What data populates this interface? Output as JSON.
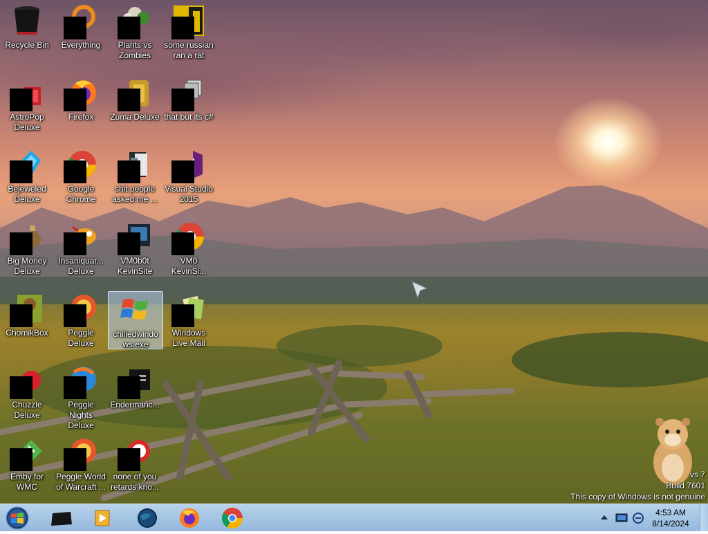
{
  "desktop_icons": [
    {
      "label": "Recycle Bin",
      "icon": "recycle-bin-icon"
    },
    {
      "label": "Everything",
      "icon": "everything-icon"
    },
    {
      "label": "Plants vs Zombies",
      "icon": "plants-vs-zombies-icon"
    },
    {
      "label": "some russian ran a rat",
      "icon": "pie-icon"
    },
    {
      "label": "AstroPop Deluxe",
      "icon": "astropop-icon"
    },
    {
      "label": "Firefox",
      "icon": "firefox-icon"
    },
    {
      "label": "Zuma Deluxe",
      "icon": "zuma-icon"
    },
    {
      "label": "that but its c#",
      "icon": "folder-stack-icon"
    },
    {
      "label": "Bejeweled Deluxe",
      "icon": "bejeweled-icon"
    },
    {
      "label": "Google Chrome",
      "icon": "chrome-icon"
    },
    {
      "label": "shit people asked me ...",
      "icon": "folder-icon"
    },
    {
      "label": "Visual Studio 2015",
      "icon": "visual-studio-icon"
    },
    {
      "label": "Big Money Deluxe",
      "icon": "big-money-icon"
    },
    {
      "label": "Insaniquar... Deluxe",
      "icon": "insaniquarium-icon"
    },
    {
      "label": "VM0b0t KevinSite",
      "icon": "vm-terminal-icon"
    },
    {
      "label": "VM0 KevinSi...",
      "icon": "chrome-icon"
    },
    {
      "label": "ChomikBox",
      "icon": "chomikbox-icon"
    },
    {
      "label": "Peggle Deluxe",
      "icon": "peggle-icon"
    },
    {
      "label": "chilledwindows.exe",
      "icon": "windows-logo-icon"
    },
    {
      "label": "Windows Live Mail",
      "icon": "windows-live-mail-icon"
    },
    {
      "label": "Chuzzle Deluxe",
      "icon": "chuzzle-icon"
    },
    {
      "label": "Peggle Nights Deluxe",
      "icon": "peggle-nights-icon"
    },
    {
      "label": "Endermanc...",
      "icon": "terminal-icon"
    },
    {
      "label": "Emby for WMC",
      "icon": "emby-icon"
    },
    {
      "label": "Peggle World of Warcraft ...",
      "icon": "peggle-wow-icon"
    },
    {
      "label": "none of you retards kno...",
      "icon": "ball-icon"
    }
  ],
  "watermark": {
    "line1": "vs 7",
    "line2": "Build 7601",
    "line3": "This copy of Windows is not genuine"
  },
  "taskbar": {
    "pinned": [
      {
        "name": "terminal",
        "icon": "terminal-icon"
      },
      {
        "name": "media center",
        "icon": "media-player-icon"
      },
      {
        "name": "globe",
        "icon": "globe-icon"
      },
      {
        "name": "firefox",
        "icon": "firefox-icon"
      },
      {
        "name": "chrome",
        "icon": "chrome-icon"
      }
    ]
  },
  "tray": {
    "time": "4:53 AM",
    "date": "8/14/2024"
  }
}
